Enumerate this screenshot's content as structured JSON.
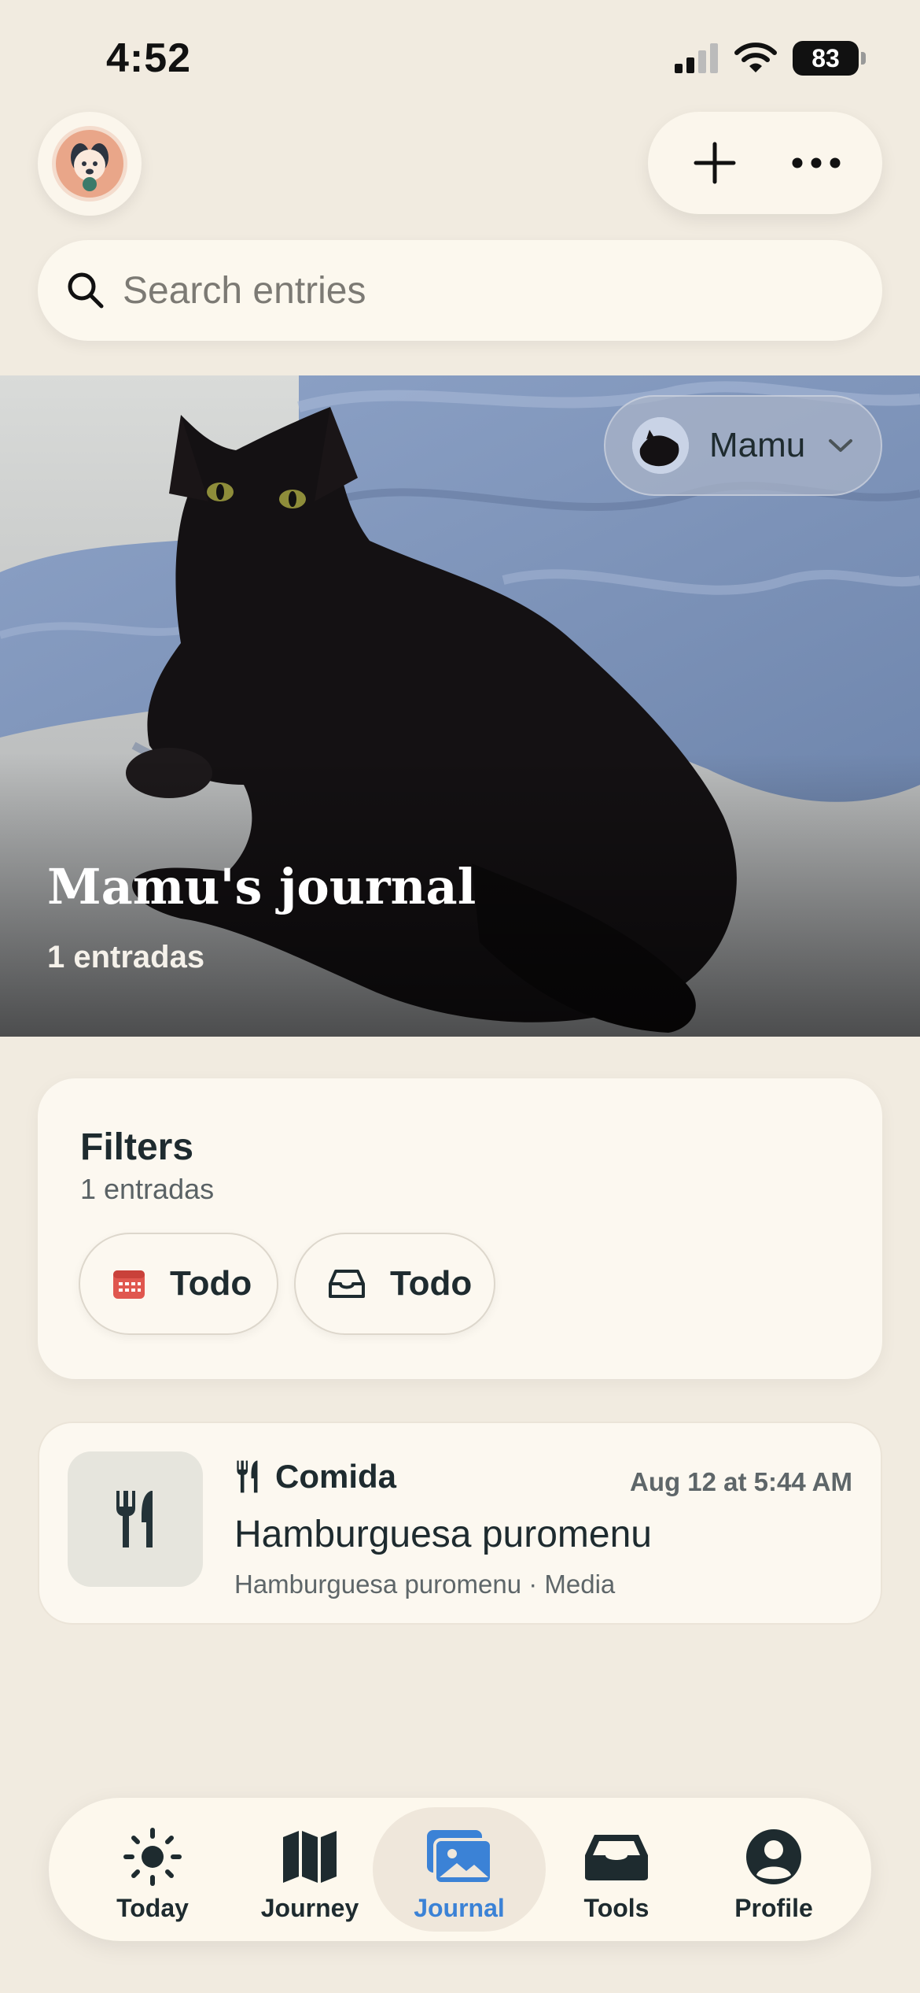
{
  "status_bar": {
    "time": "4:52",
    "battery": "83"
  },
  "search": {
    "placeholder": "Search entries"
  },
  "hero": {
    "title": "Mamu's journal",
    "count": "1 entradas",
    "pet_selector": "Mamu"
  },
  "filters": {
    "title": "Filters",
    "count": "1 entradas",
    "chips": [
      {
        "icon": "calendar-icon",
        "label": "Todo"
      },
      {
        "icon": "inbox-icon",
        "label": "Todo"
      }
    ]
  },
  "entries": [
    {
      "icon": "fork-knife-icon",
      "category": "Comida",
      "time": "Aug 12 at 5:44 AM",
      "title": "Hamburguesa puromenu",
      "subtitle": "Hamburguesa puromenu · Media"
    }
  ],
  "tabbar": {
    "active": "Journal",
    "accent_color": "#3b82d6",
    "tabs": [
      {
        "label": "Today",
        "icon": "sun-icon"
      },
      {
        "label": "Journey",
        "icon": "map-icon"
      },
      {
        "label": "Journal",
        "icon": "photos-icon"
      },
      {
        "label": "Tools",
        "icon": "tray-icon"
      },
      {
        "label": "Profile",
        "icon": "person-icon"
      }
    ]
  }
}
